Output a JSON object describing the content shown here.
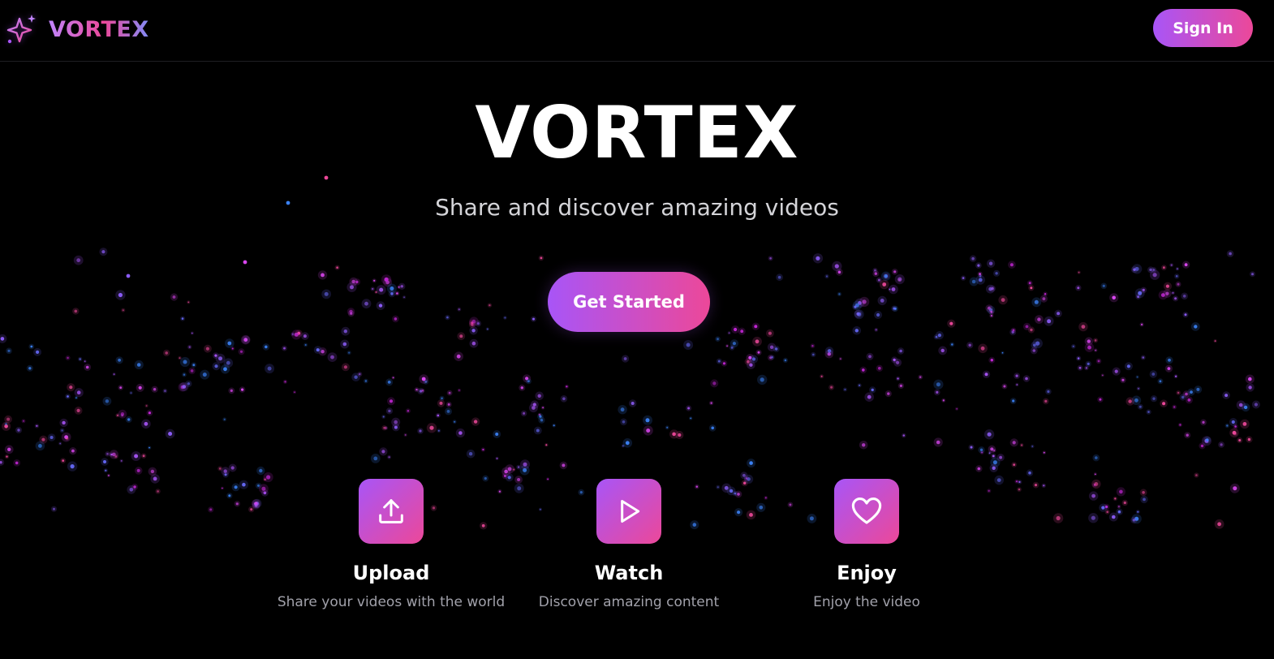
{
  "header": {
    "logo_text": "VORTEX",
    "logo_icon": "sparkles-icon",
    "sign_in_label": "Sign In"
  },
  "hero": {
    "title": "VORTEX",
    "subtitle": "Share and discover amazing videos",
    "cta_label": "Get Started"
  },
  "features": [
    {
      "icon": "upload-icon",
      "title": "Upload",
      "description": "Share your videos with the world"
    },
    {
      "icon": "play-icon",
      "title": "Watch",
      "description": "Discover amazing content"
    },
    {
      "icon": "heart-icon",
      "title": "Enjoy",
      "description": "Enjoy the video"
    }
  ],
  "colors": {
    "background": "#000000",
    "accent_purple": "#a855f7",
    "accent_pink": "#ec4899",
    "particle_blue": "#3b82f6"
  }
}
